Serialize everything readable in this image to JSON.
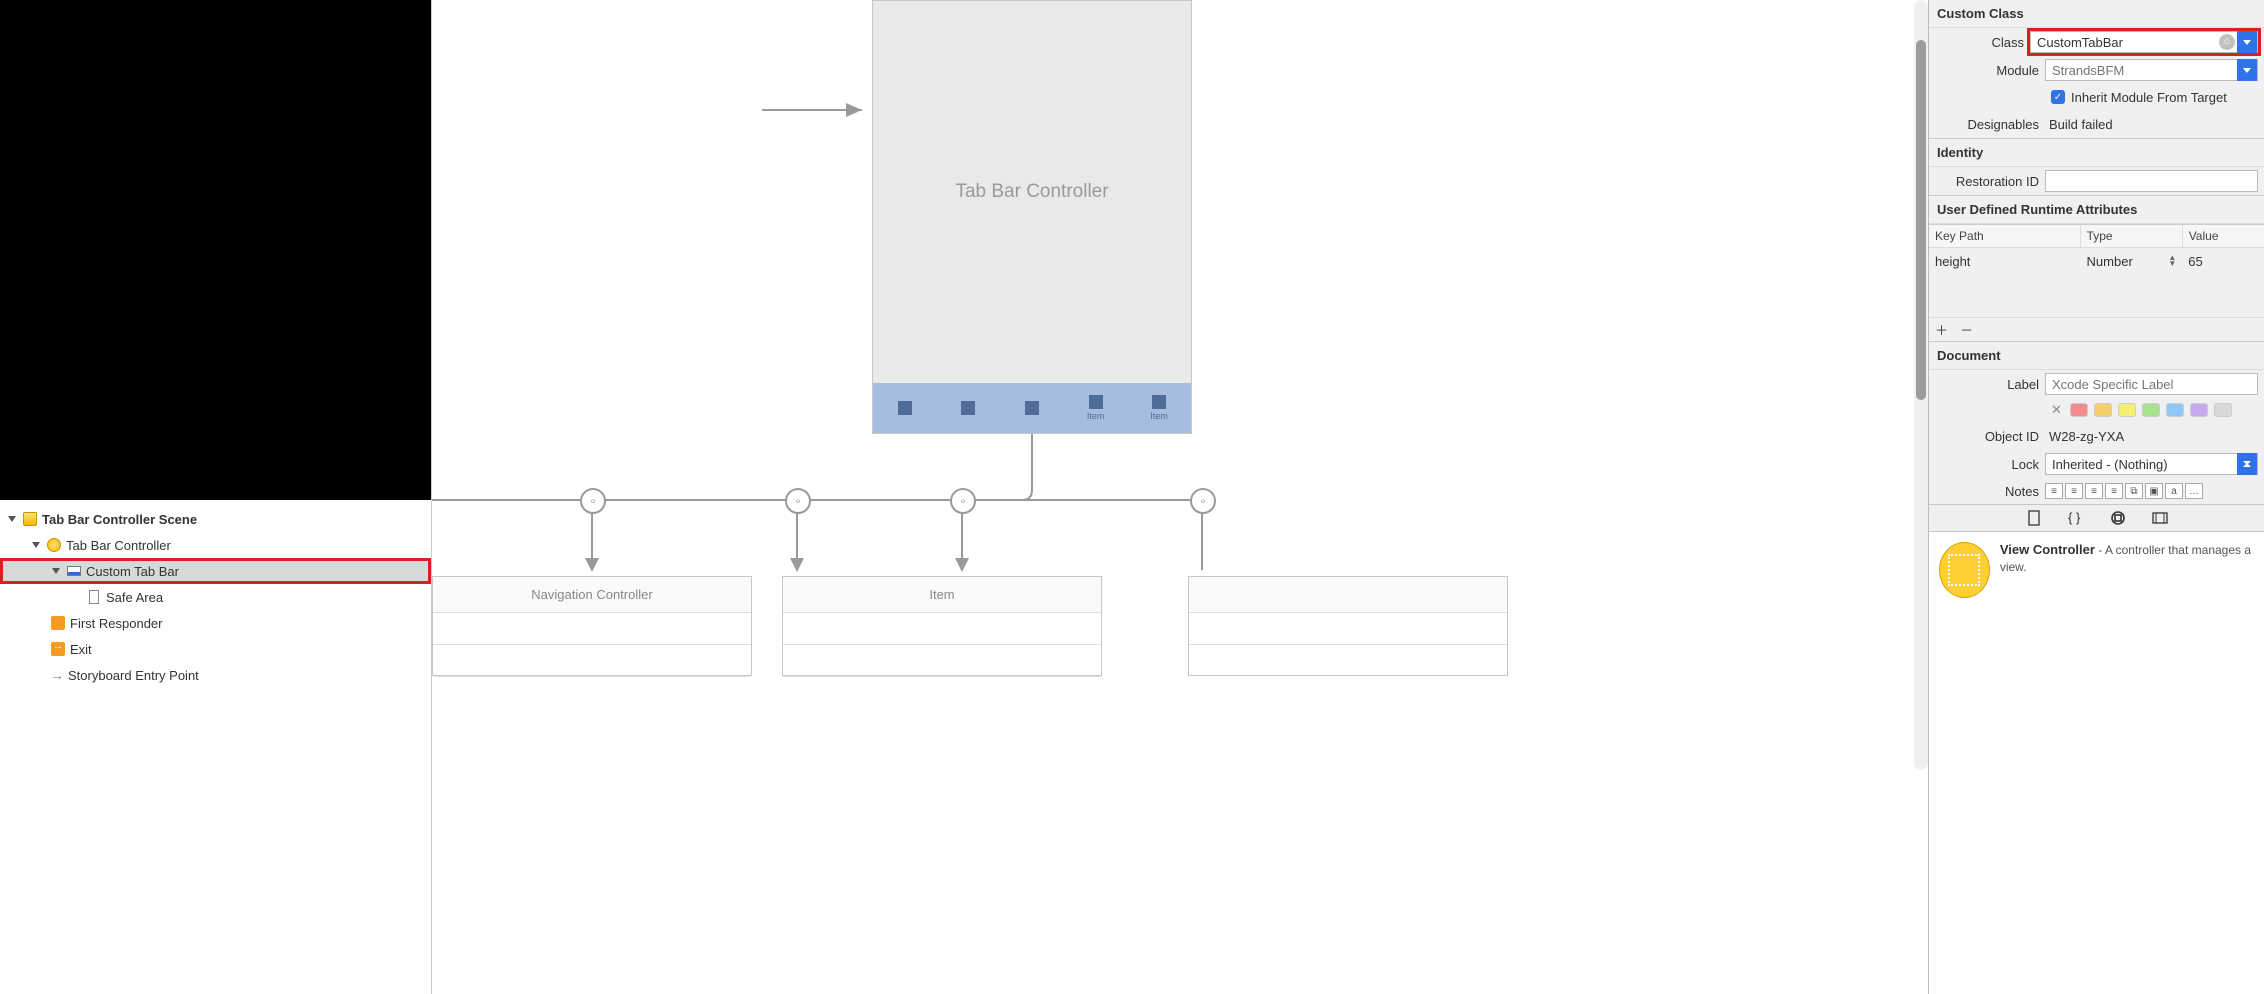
{
  "scene_tree": {
    "root": "Tab Bar Controller Scene",
    "items": [
      {
        "label": "Tab Bar Controller"
      },
      {
        "label": "Custom Tab Bar"
      },
      {
        "label": "Safe Area"
      },
      {
        "label": "First Responder"
      },
      {
        "label": "Exit"
      },
      {
        "label": "Storyboard Entry Point"
      }
    ]
  },
  "canvas": {
    "vc_title": "Tab Bar Controller",
    "tabbar_items": [
      "",
      "",
      "",
      "Item",
      "Item"
    ],
    "child0": "Navigation Controller",
    "child1": "Item"
  },
  "inspector": {
    "custom_class": {
      "header": "Custom Class",
      "class_label": "Class",
      "class_value": "CustomTabBar",
      "module_label": "Module",
      "module_placeholder": "StrandsBFM",
      "inherit_label": "Inherit Module From Target",
      "designables_label": "Designables",
      "designables_value": "Build failed"
    },
    "identity": {
      "header": "Identity",
      "restoration_label": "Restoration ID"
    },
    "udra": {
      "header": "User Defined Runtime Attributes",
      "col_keypath": "Key Path",
      "col_type": "Type",
      "col_value": "Value",
      "row_keypath": "height",
      "row_type": "Number",
      "row_value": "65"
    },
    "document": {
      "header": "Document",
      "label_label": "Label",
      "label_placeholder": "Xcode Specific Label",
      "objectid_label": "Object ID",
      "objectid_value": "W28-zg-YXA",
      "lock_label": "Lock",
      "lock_value": "Inherited - (Nothing)",
      "notes_label": "Notes",
      "swatch_colors": [
        "#f08c8c",
        "#f6ce6a",
        "#f4ee71",
        "#a9e28f",
        "#8fc8f4",
        "#c6aaf0",
        "#d9d9d9"
      ]
    },
    "library": {
      "title": "View Controller",
      "desc": " - A controller that manages a view."
    }
  }
}
